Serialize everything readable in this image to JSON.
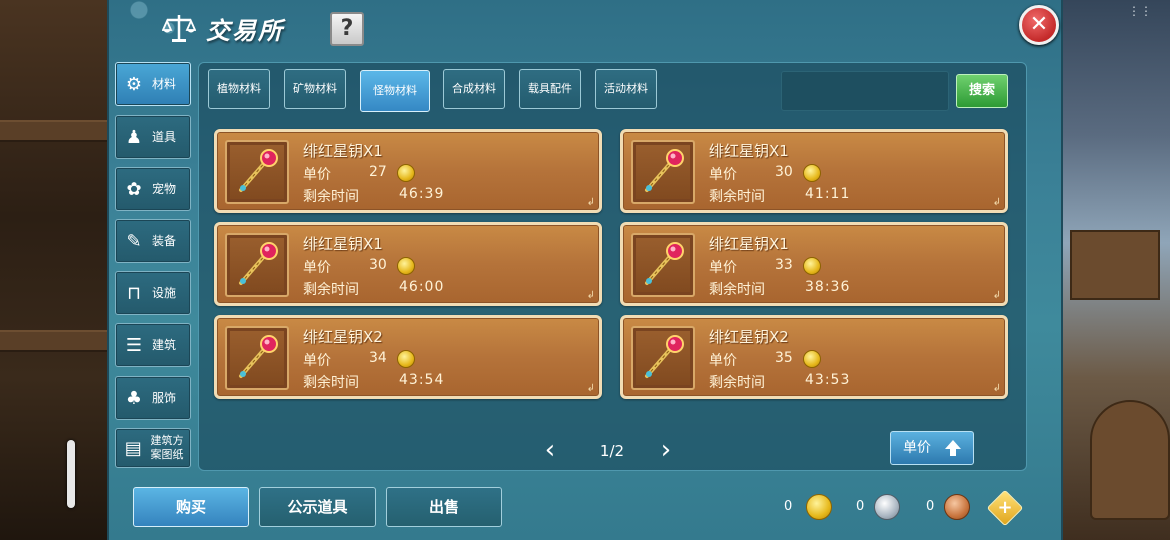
{
  "window": {
    "title": "交易所",
    "help_label": "?",
    "close_label": "✕"
  },
  "top_dots": "⋮⋮",
  "sidebar": {
    "items": [
      {
        "label": "材料",
        "icon": "materials-icon",
        "glyph": "⚙",
        "active": true
      },
      {
        "label": "道具",
        "icon": "props-icon",
        "glyph": "♟",
        "active": false
      },
      {
        "label": "宠物",
        "icon": "paw-icon",
        "glyph": "✿",
        "active": false
      },
      {
        "label": "装备",
        "icon": "equipment-icon",
        "glyph": "✎",
        "active": false
      },
      {
        "label": "设施",
        "icon": "facility-icon",
        "glyph": "⊓",
        "active": false
      },
      {
        "label": "建筑",
        "icon": "building-icon",
        "glyph": "☰",
        "active": false
      },
      {
        "label": "服饰",
        "icon": "clothing-icon",
        "glyph": "♣",
        "active": false
      },
      {
        "label": "建筑方案图纸",
        "icon": "blueprint-icon",
        "glyph": "▤",
        "active": false
      }
    ]
  },
  "tabs": [
    {
      "label": "植物材料",
      "active": false
    },
    {
      "label": "矿物材料",
      "active": false
    },
    {
      "label": "怪物材料",
      "active": true
    },
    {
      "label": "合成材料",
      "active": false
    },
    {
      "label": "载具配件",
      "active": false
    },
    {
      "label": "活动材料",
      "active": false
    }
  ],
  "search": {
    "placeholder": "",
    "button_label": "搜索"
  },
  "listing_labels": {
    "price": "单价",
    "time_left": "剩余时间"
  },
  "listings": [
    {
      "name": "绯红星钥X1",
      "price": "27",
      "time": "46:39"
    },
    {
      "name": "绯红星钥X1",
      "price": "30",
      "time": "41:11"
    },
    {
      "name": "绯红星钥X1",
      "price": "30",
      "time": "46:00"
    },
    {
      "name": "绯红星钥X1",
      "price": "33",
      "time": "38:36"
    },
    {
      "name": "绯红星钥X2",
      "price": "34",
      "time": "43:54"
    },
    {
      "name": "绯红星钥X2",
      "price": "35",
      "time": "43:53"
    }
  ],
  "pager": {
    "text": "1/2",
    "prev": "‹",
    "next": "›"
  },
  "sort": {
    "label": "单价"
  },
  "bottom": {
    "buy_label": "购买",
    "public_label": "公示道具",
    "sell_label": "出售"
  },
  "currency": {
    "gold": "0",
    "silver": "0",
    "copper": "0",
    "add_label": "+"
  },
  "colors": {
    "panel": "#3b8197",
    "card": "#b5733a",
    "active_tab": "#3588c4",
    "search_button": "#2d9a34",
    "close_button": "#c42a2a"
  }
}
